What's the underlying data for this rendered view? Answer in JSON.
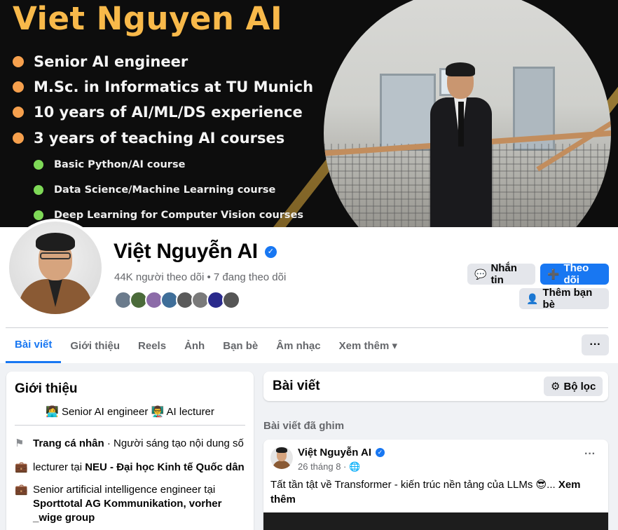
{
  "cover": {
    "title": "Viet Nguyen AI",
    "bullets": [
      "Senior AI engineer",
      "M.Sc. in Informatics at TU Munich",
      "10 years of AI/ML/DS experience",
      "3 years of teaching AI courses"
    ],
    "sub_bullets": [
      "Basic Python/AI course",
      "Data Science/Machine Learning course",
      "Deep Learning for Computer Vision courses"
    ],
    "bullet_color": "#f6a04d",
    "sub_bullet_color": "#7ed957",
    "title_color": "#f8b94a"
  },
  "profile": {
    "name": "Việt Nguyễn AI",
    "verified_icon": "verified-badge-icon",
    "followers": "44K người theo dõi • 7 đang theo dõi",
    "friend_avatar_colors": [
      "#6b7b8c",
      "#4b6b3a",
      "#8c6ba8",
      "#3f6e99",
      "#5a5a5a",
      "#7a7a7a",
      "#2a2a8c",
      "#555555"
    ]
  },
  "actions": {
    "message": "Nhắn tin",
    "follow": "Theo dõi",
    "add_friend": "Thêm bạn bè"
  },
  "tabs": [
    "Bài viết",
    "Giới thiệu",
    "Reels",
    "Ảnh",
    "Bạn bè",
    "Âm nhạc",
    "Xem thêm ▾"
  ],
  "more_label": "···",
  "intro": {
    "title": "Giới thiệu",
    "bio": "👩‍💻 Senior AI engineer 👨‍🏫 AI lecturer",
    "rows": [
      {
        "icon": "flag-icon",
        "bold": "Trang cá nhân",
        "text": " · Người sáng tạo nội dung số"
      },
      {
        "icon": "briefcase-icon",
        "prefix": "lecturer tại ",
        "bold": "NEU - Đại học Kinh tế Quốc dân"
      },
      {
        "icon": "briefcase-icon",
        "prefix": "Senior artificial intelligence engineer tại ",
        "bold": "Sporttotal AG Kommunikation, vorher _wige group"
      }
    ]
  },
  "posts": {
    "title": "Bài viết",
    "filter": "Bộ lọc",
    "pinned_label": "Bài viết đã ghim",
    "post": {
      "author": "Việt Nguyễn AI",
      "date": "26 tháng 8 · 🌐",
      "text": "Tất tần tật về Transformer - kiến trúc nền tảng của LLMs 😎... ",
      "see_more": "Xem thêm",
      "more": "···"
    }
  },
  "colors": {
    "accent": "#1877f2",
    "page_bg": "#f0f2f5"
  }
}
